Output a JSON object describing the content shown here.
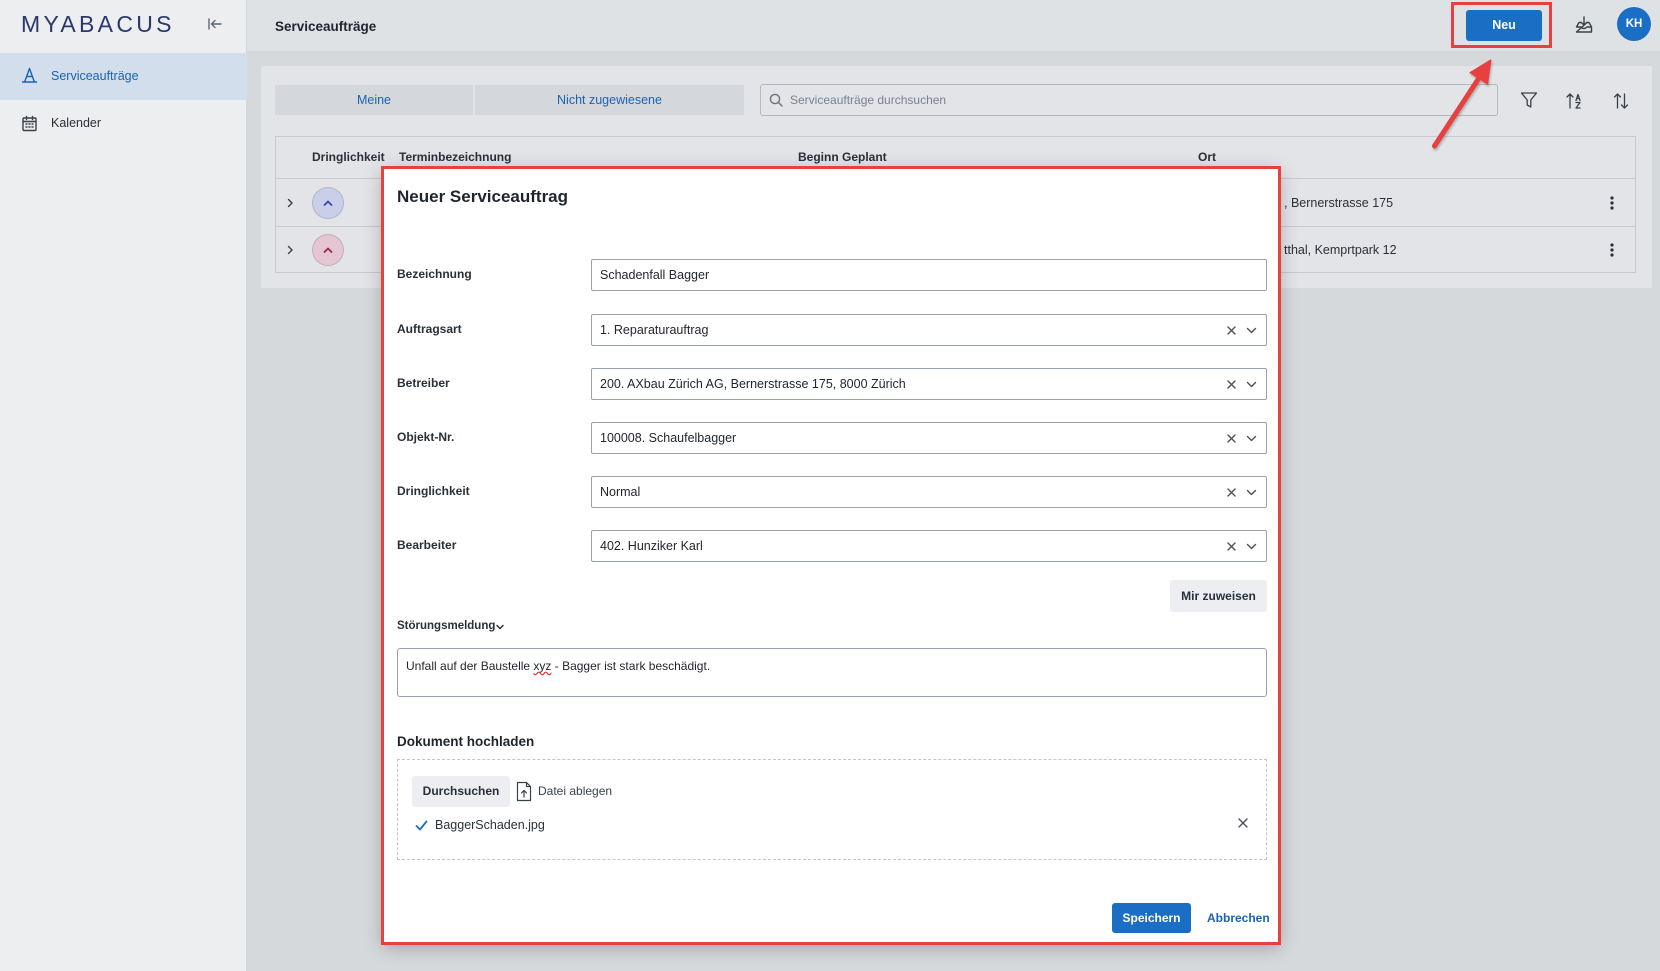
{
  "app": {
    "logo": "MYABACUS",
    "page_title": "Serviceaufträge"
  },
  "sidebar": {
    "items": [
      {
        "label": "Serviceaufträge",
        "icon": "traffic-cone-icon",
        "active": true
      },
      {
        "label": "Kalender",
        "icon": "calendar-icon",
        "active": false
      }
    ]
  },
  "header": {
    "new_button": "Neu",
    "avatar_initials": "KH",
    "download_icon": "download-tray-icon"
  },
  "toolbar": {
    "tabs": [
      {
        "label": "Meine"
      },
      {
        "label": "Nicht zugewiesene"
      }
    ],
    "search_placeholder": "Serviceaufträge durchsuchen",
    "icons": [
      "filter-icon",
      "sort-alphabetical-icon",
      "sort-order-icon"
    ]
  },
  "table": {
    "columns": [
      "Dringlichkeit",
      "Terminbezeichnung",
      "Beginn Geplant",
      "Ort"
    ],
    "rows": [
      {
        "urgency_icon": "chevron-up-icon",
        "urgency_color": "#3348b0",
        "urgency_bg": "#c9cfe9",
        "ort": ", Bernerstrasse 175"
      },
      {
        "urgency_icon": "chevron-up-icon",
        "urgency_color": "#a0234d",
        "urgency_bg": "#e3c6d1",
        "ort": "tthal, Kemprtpark 12"
      }
    ]
  },
  "modal": {
    "title": "Neuer Serviceauftrag",
    "fields": [
      {
        "label": "Bezeichnung",
        "value": "Schadenfall Bagger",
        "clearable": false
      },
      {
        "label": "Auftragsart",
        "value": "1. Reparaturauftrag",
        "clearable": true
      },
      {
        "label": "Betreiber",
        "value": "200. AXbau Zürich AG, Bernerstrasse 175, 8000 Zürich",
        "clearable": true
      },
      {
        "label": "Objekt-Nr.",
        "value": "100008. Schaufelbagger",
        "clearable": true
      },
      {
        "label": "Dringlichkeit",
        "value": "Normal",
        "clearable": true
      },
      {
        "label": "Bearbeiter",
        "value": "402. Hunziker Karl",
        "clearable": true
      }
    ],
    "assign_me": "Mir zuweisen",
    "fault_report": {
      "label": "Störungsmeldung",
      "text_before": "Unfall auf der Baustelle ",
      "text_flagged": "xyz",
      "text_after": " - Bagger ist stark beschädigt."
    },
    "upload": {
      "title": "Dokument hochladen",
      "browse": "Durchsuchen",
      "drop_hint": "Datei ablegen",
      "files": [
        {
          "name": "BaggerSchaden.jpg",
          "status_icon": "check-icon"
        }
      ]
    },
    "save": "Speichern",
    "cancel": "Abbrechen"
  },
  "colors": {
    "accent": "#1a6fc4",
    "annotation": "#e8403e",
    "nav_active_bg": "#d2deeb",
    "link_text": "#1b63b3"
  }
}
